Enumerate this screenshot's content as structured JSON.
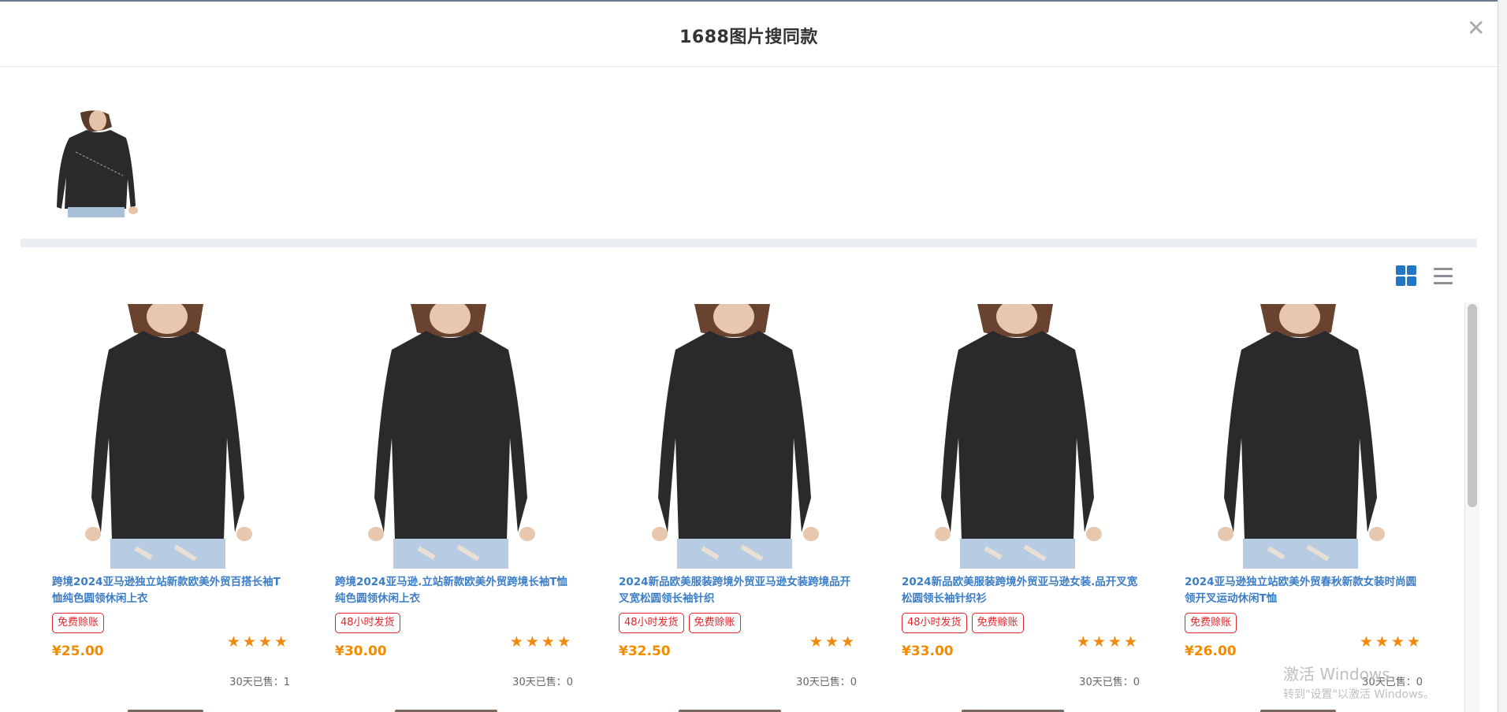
{
  "dialog": {
    "title": "1688图片搜同款",
    "close_icon": "close-icon"
  },
  "query_image": {
    "icon": "shirt-model-photo"
  },
  "view_toggle": {
    "grid_icon": "grid-view-icon",
    "list_icon": "list-view-icon",
    "active": "grid"
  },
  "colors": {
    "accent": "#2276c4",
    "title_link": "#3b7dc7",
    "price": "#f28b00",
    "tag": "#e2252b",
    "star": "#f0890d"
  },
  "products": [
    {
      "title": "跨境2024亚马逊独立站新款欧美外贸百搭长袖T恤纯色圆领休闲上衣",
      "tags": [
        "免费赊账"
      ],
      "price": "¥25.00",
      "rating": 4,
      "stars_text": "★★★★",
      "sold": "30天已售：1"
    },
    {
      "title": "跨境2024亚马逊.立站新款欧美外贸跨境长袖T恤纯色圆领休闲上衣",
      "tags": [
        "48小时发货"
      ],
      "price": "¥30.00",
      "rating": 3.5,
      "stars_text": "★★★★",
      "sold": "30天已售：0"
    },
    {
      "title": "2024新品欧美服装跨境外贸亚马逊女装跨境品开叉宽松圆领长袖针织",
      "tags": [
        "48小时发货",
        "免费赊账"
      ],
      "price": "¥32.50",
      "rating": 3,
      "stars_text": "★★★",
      "sold": "30天已售：0"
    },
    {
      "title": "2024新品欧美服装跨境外贸亚马逊女装.品开叉宽松圆领长袖针织衫",
      "tags": [
        "48小时发货",
        "免费赊账"
      ],
      "price": "¥33.00",
      "rating": 4,
      "stars_text": "★★★★",
      "sold": "30天已售：0"
    },
    {
      "title": "2024亚马逊独立站欧美外贸春秋新款女装时尚圆领开叉运动休闲T恤",
      "tags": [
        "免费赊账"
      ],
      "price": "¥26.00",
      "rating": 4,
      "stars_text": "★★★★",
      "sold": "30天已售：0"
    }
  ],
  "watermark": {
    "line1": "激活 Windows",
    "line2": "转到\"设置\"以激活 Windows。"
  }
}
